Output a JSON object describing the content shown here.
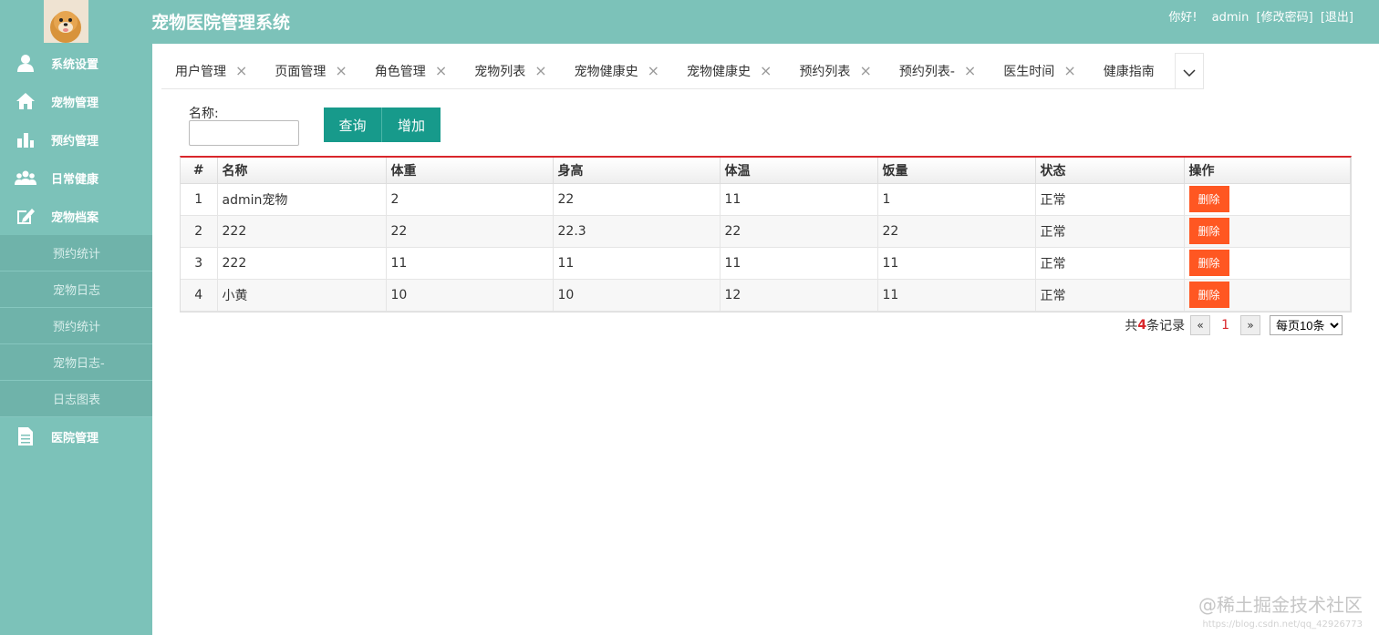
{
  "header": {
    "title": "宠物医院管理系统",
    "greeting": "你好!",
    "username": "admin",
    "change_password": "[修改密码]",
    "logout": "[退出]"
  },
  "sidebar": {
    "items": [
      {
        "label": "系统设置",
        "icon": "user-icon"
      },
      {
        "label": "宠物管理",
        "icon": "home-icon"
      },
      {
        "label": "预约管理",
        "icon": "bar-chart-icon"
      },
      {
        "label": "日常健康",
        "icon": "group-icon"
      },
      {
        "label": "宠物档案",
        "icon": "edit-icon"
      }
    ],
    "subitems": [
      "预约统计",
      "宠物日志",
      "预约统计",
      "宠物日志-",
      "日志图表"
    ],
    "last_item": {
      "label": "医院管理",
      "icon": "document-icon"
    }
  },
  "tabs": [
    {
      "label": "用户管理"
    },
    {
      "label": "页面管理"
    },
    {
      "label": "角色管理"
    },
    {
      "label": "宠物列表"
    },
    {
      "label": "宠物健康史"
    },
    {
      "label": "宠物健康史"
    },
    {
      "label": "预约列表"
    },
    {
      "label": "预约列表-"
    },
    {
      "label": "医生时间"
    },
    {
      "label": "健康指南"
    }
  ],
  "search": {
    "label": "名称:",
    "value": "",
    "query_button": "查询",
    "add_button": "增加"
  },
  "table": {
    "headers": [
      "#",
      "名称",
      "体重",
      "身高",
      "体温",
      "饭量",
      "状态",
      "操作"
    ],
    "rows": [
      [
        "1",
        "admin宠物",
        "2",
        "22",
        "11",
        "1",
        "正常"
      ],
      [
        "2",
        "222",
        "22",
        "22.3",
        "22",
        "22",
        "正常"
      ],
      [
        "3",
        "222",
        "11",
        "11",
        "11",
        "11",
        "正常"
      ],
      [
        "4",
        "小黄",
        "10",
        "10",
        "12",
        "11",
        "正常"
      ]
    ],
    "delete_label": "删除"
  },
  "pagination": {
    "prefix": "共",
    "total": "4",
    "suffix": "条记录",
    "prev": "«",
    "current": "1",
    "next": "»",
    "page_size": "每页10条"
  },
  "watermark": "@稀土掘金技术社区",
  "watermark_url": "https://blog.csdn.net/qq_42926773",
  "colors": {
    "primary": "#7cc2b9",
    "button": "#179a8b",
    "danger": "#ff5722",
    "accent_red": "#d9262b"
  }
}
